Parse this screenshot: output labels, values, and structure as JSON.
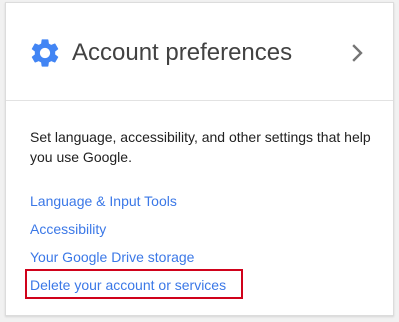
{
  "card": {
    "title": "Account preferences",
    "icon": "gear-icon",
    "chevron_icon": "chevron-right-icon",
    "description": "Set language, accessibility, and other settings that help you use Google.",
    "links": [
      {
        "label": "Language & Input Tools"
      },
      {
        "label": "Accessibility"
      },
      {
        "label": "Your Google Drive storage"
      },
      {
        "label": "Delete your account or services"
      }
    ],
    "highlighted_link_index": 3
  },
  "colors": {
    "gear_icon": "#4285f4",
    "title_text": "#424242",
    "link_text": "#3b78e7",
    "highlight_border": "#d0021b",
    "chevron": "#757575"
  }
}
